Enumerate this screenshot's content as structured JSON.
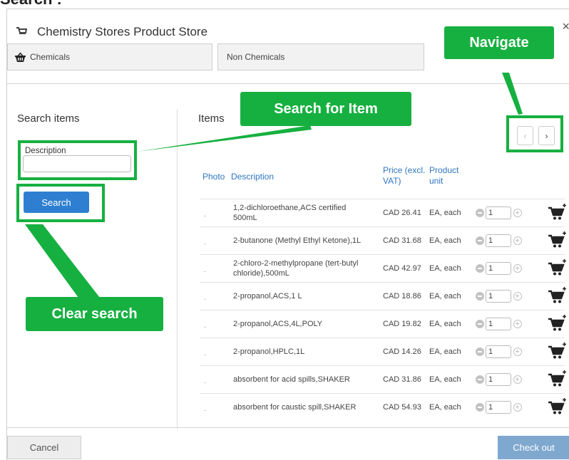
{
  "page": {
    "heading": "Search :"
  },
  "modal": {
    "title": "Chemistry Stores Product Store",
    "close_glyph": "×"
  },
  "tabs": [
    {
      "label": "Chemicals",
      "icon": "basket-icon"
    },
    {
      "label": "Non Chemicals"
    }
  ],
  "search": {
    "title": "Search items",
    "description_label": "Description",
    "description_value": "",
    "button_label": "Search"
  },
  "items": {
    "title": "Items",
    "pager_prev": "‹",
    "pager_next": "›",
    "headers": {
      "photo": "Photo",
      "description": "Description",
      "price": "Price (excl. VAT)",
      "unit": "Product unit"
    },
    "rows": [
      {
        "photo": ".",
        "description": "1,2-dichloroethane,ACS certified 500mL",
        "price": "CAD 26.41",
        "unit": "EA, each",
        "qty": "1"
      },
      {
        "photo": ".",
        "description": "2-butanone (Methyl Ethyl Ketone),1L",
        "price": "CAD 31.68",
        "unit": "EA, each",
        "qty": "1"
      },
      {
        "photo": ".",
        "description": "2-chloro-2-methylpropane (tert-butyl chloride),500mL",
        "price": "CAD 42.97",
        "unit": "EA, each",
        "qty": "1"
      },
      {
        "photo": ".",
        "description": "2-propanol,ACS,1 L",
        "price": "CAD 18.86",
        "unit": "EA, each",
        "qty": "1"
      },
      {
        "photo": ".",
        "description": "2-propanol,ACS,4L,POLY",
        "price": "CAD 19.82",
        "unit": "EA, each",
        "qty": "1"
      },
      {
        "photo": ".",
        "description": "2-propanol,HPLC,1L",
        "price": "CAD 14.26",
        "unit": "EA, each",
        "qty": "1"
      },
      {
        "photo": ".",
        "description": "absorbent for acid spills,SHAKER",
        "price": "CAD 31.86",
        "unit": "EA, each",
        "qty": "1"
      },
      {
        "photo": ".",
        "description": "absorbent for caustic spill,SHAKER",
        "price": "CAD 54.93",
        "unit": "EA, each",
        "qty": "1"
      }
    ]
  },
  "footer": {
    "cancel_label": "Cancel",
    "checkout_label": "Check out"
  },
  "annotations": {
    "navigate": "Navigate",
    "search_for_item": "Search for Item",
    "clear_search": "Clear search"
  },
  "colors": {
    "accent": "#2e7fd1",
    "annotation": "#16b040",
    "checkout": "#7fa8cf"
  }
}
